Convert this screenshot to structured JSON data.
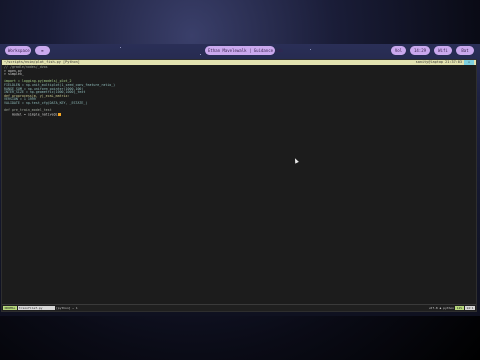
{
  "panel": {
    "left_pill_1": "Workspace",
    "left_pill_2": "≡",
    "center_pill": "Ethan Mavelewalk | Guidance Lab",
    "right_pill_1": "Vol",
    "right_pill_2": "14:29",
    "right_pill_3": "Wifi",
    "right_pill_4": "Bat"
  },
  "terminal": {
    "title_left": "~/scripts/nvim/plot_fish.py [Python]",
    "title_right": "sanity@laptop 21:37:03",
    "title_btn": "x",
    "lines": [
      {
        "text": "// /gradle/nodes/_dvos",
        "cls": "c-dim"
      },
      {
        "text": "> open.py",
        "cls": "c-pr"
      },
      {
        "text": "> simplex_",
        "cls": "c-pr"
      },
      {
        "text": "",
        "cls": "c-pr"
      },
      {
        "text": "import = logging.py(models)_plot_2",
        "cls": "c-ok"
      },
      {
        "text": "FIELDLEN = np.unit_multiplot(1_seed_conv_feature_ratio_)",
        "cls": "c-key"
      },
      {
        "text": "RANGE_SUM = np.uniform_pointer(1000,100)",
        "cls": "c-key"
      },
      {
        "text": "INTER_SIZE = np.geometric(1000,1000)_text",
        "cls": "c-key"
      },
      {
        "text": "def proprocess(m, y)_ecaL_matrix:",
        "cls": "c-tex"
      },
      {
        "text": "VERSION = 1 1999",
        "cls": "c-key"
      },
      {
        "text": "VALIDATE = np.test_cfg(DATA_KEY, _ESTATE_)",
        "cls": "c-key"
      },
      {
        "text": "",
        "cls": "c-pr"
      },
      {
        "text": "def pre_train_model_test",
        "cls": "c-dim"
      },
      {
        "text": "    model = simple_nativeQL",
        "cls": "c-pr"
      }
    ],
    "status": {
      "mode": "NORMAL",
      "file": "trainfilef.py",
      "lang": "[python] ~ 1",
      "position": "utf-8 ◆ python",
      "percent": "12%",
      "end": "14:1"
    }
  }
}
